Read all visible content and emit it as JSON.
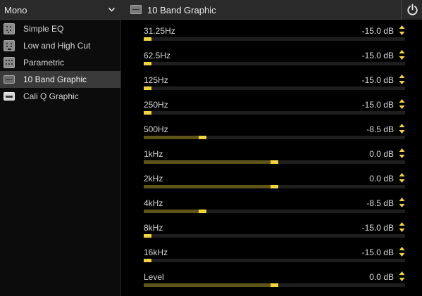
{
  "left_panel": {
    "mode_select": {
      "value": "Mono"
    },
    "items": [
      {
        "label": "Simple EQ",
        "icon": "simple-eq-pedal-icon",
        "selected": false
      },
      {
        "label": "Low and High Cut",
        "icon": "low-high-cut-pedal-icon",
        "selected": false
      },
      {
        "label": "Parametric",
        "icon": "parametric-pedal-icon",
        "selected": false
      },
      {
        "label": "10 Band Graphic",
        "icon": "graphic-eq-rack-icon",
        "selected": true
      },
      {
        "label": "Cali Q Graphic",
        "icon": "cali-q-rack-icon",
        "selected": false
      }
    ]
  },
  "header": {
    "title": "10 Band Graphic",
    "icon": "graphic-eq-rack-icon",
    "power_icon": "power-icon"
  },
  "params": [
    {
      "label": "31.25Hz",
      "value": "-15.0 dB",
      "level": 0.0
    },
    {
      "label": "62.5Hz",
      "value": "-15.0 dB",
      "level": 0.0
    },
    {
      "label": "125Hz",
      "value": "-15.0 dB",
      "level": 0.0
    },
    {
      "label": "250Hz",
      "value": "-15.0 dB",
      "level": 0.0
    },
    {
      "label": "500Hz",
      "value": "-8.5 dB",
      "level": 0.217
    },
    {
      "label": "1kHz",
      "value": "0.0 dB",
      "level": 0.5
    },
    {
      "label": "2kHz",
      "value": "0.0 dB",
      "level": 0.5
    },
    {
      "label": "4kHz",
      "value": "-8.5 dB",
      "level": 0.217
    },
    {
      "label": "8kHz",
      "value": "-15.0 dB",
      "level": 0.0
    },
    {
      "label": "16kHz",
      "value": "-15.0 dB",
      "level": 0.0
    },
    {
      "label": "Level",
      "value": "0.0 dB",
      "level": 0.5
    }
  ],
  "colors": {
    "accent": "#f2d43a",
    "fill": "#5e5318",
    "track": "#1e1e1e",
    "panel": "#2a2a2a",
    "selected": "#3a3a3a"
  }
}
